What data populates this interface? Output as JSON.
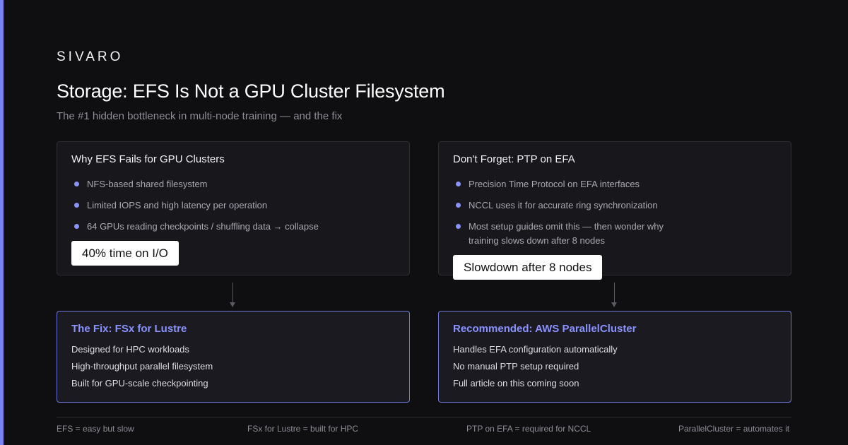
{
  "brand": "SIVARO",
  "title": "Storage: EFS Is Not a GPU Cluster Filesystem",
  "subtitle": "The #1 hidden bottleneck in multi-node training — and the fix",
  "efs_card": {
    "title": "Why EFS Fails for GPU Clusters",
    "bullets": [
      "NFS-based shared filesystem",
      "Limited IOPS and high latency per operation",
      "64 GPUs reading checkpoints / shuffling data → collapse"
    ],
    "badge": "40% time on I/O"
  },
  "ptp_card": {
    "title": "Don't Forget: PTP on EFA",
    "bullets": [
      "Precision Time Protocol on EFA interfaces",
      "NCCL uses it for accurate ring synchronization",
      "Most setup guides omit this — then wonder why training slows down after 8 nodes"
    ],
    "badge": "Slowdown after 8 nodes"
  },
  "fix_card": {
    "title": "The Fix: FSx for Lustre",
    "lines": [
      "Designed for HPC workloads",
      "High-throughput parallel filesystem",
      "Built for GPU-scale checkpointing"
    ]
  },
  "recommend_card": {
    "title": "Recommended: AWS ParallelCluster",
    "lines": [
      "Handles EFA configuration automatically",
      "No manual PTP setup required",
      "Full article on this coming soon"
    ]
  },
  "footer": [
    "EFS = easy but slow",
    "FSx for Lustre = built for HPC",
    "PTP on EFA = required for NCCL",
    "ParallelCluster = automates it"
  ],
  "colors": {
    "accent": "#8a92ff",
    "background": "#0f0f12",
    "card": "#18181c"
  },
  "icons": {
    "bullet": "dot-bullet-icon",
    "arrow": "arrow-down-icon"
  }
}
